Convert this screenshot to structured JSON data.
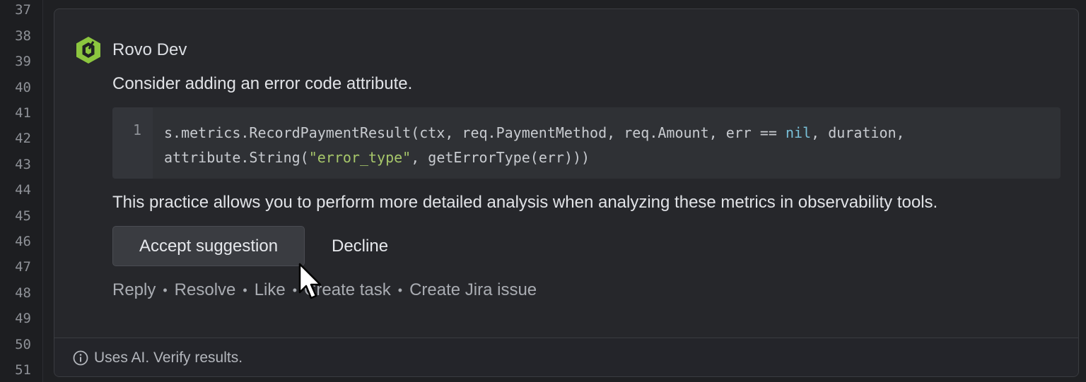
{
  "gutter": {
    "line_numbers": [
      "37",
      "38",
      "39",
      "40",
      "41",
      "42",
      "43",
      "44",
      "45",
      "46",
      "47",
      "48",
      "49",
      "50",
      "51"
    ]
  },
  "comment": {
    "author": "Rovo Dev",
    "logo_icon": "rovo-dev-hexagon-logo",
    "message": "Consider adding an error code attribute.",
    "code": {
      "line_number": "1",
      "line1_before": "s.metrics.RecordPaymentResult(ctx, req.PaymentMethod, req.Amount, err == ",
      "line1_keyword": "nil",
      "line1_after": ", duration,",
      "line2_before": "attribute.String(",
      "line2_string": "\"error_type\"",
      "line2_after": ", getErrorType(err)))"
    },
    "explanation": "This practice allows you to perform more detailed analysis when analyzing these metrics in observability tools.",
    "buttons": {
      "accept": "Accept suggestion",
      "decline": "Decline"
    },
    "actions": {
      "reply": "Reply",
      "resolve": "Resolve",
      "like": "Like",
      "create_task": "Create task",
      "create_jira": "Create Jira issue",
      "separator": "•"
    },
    "footer": {
      "icon": "info-icon",
      "text": "Uses AI. Verify results."
    }
  },
  "colors": {
    "background": "#1f2023",
    "card": "#26272b",
    "code_bg": "#2f3135",
    "logo_green": "#8cc63f",
    "keyword": "#79c0d8",
    "string": "#a7c76a"
  }
}
